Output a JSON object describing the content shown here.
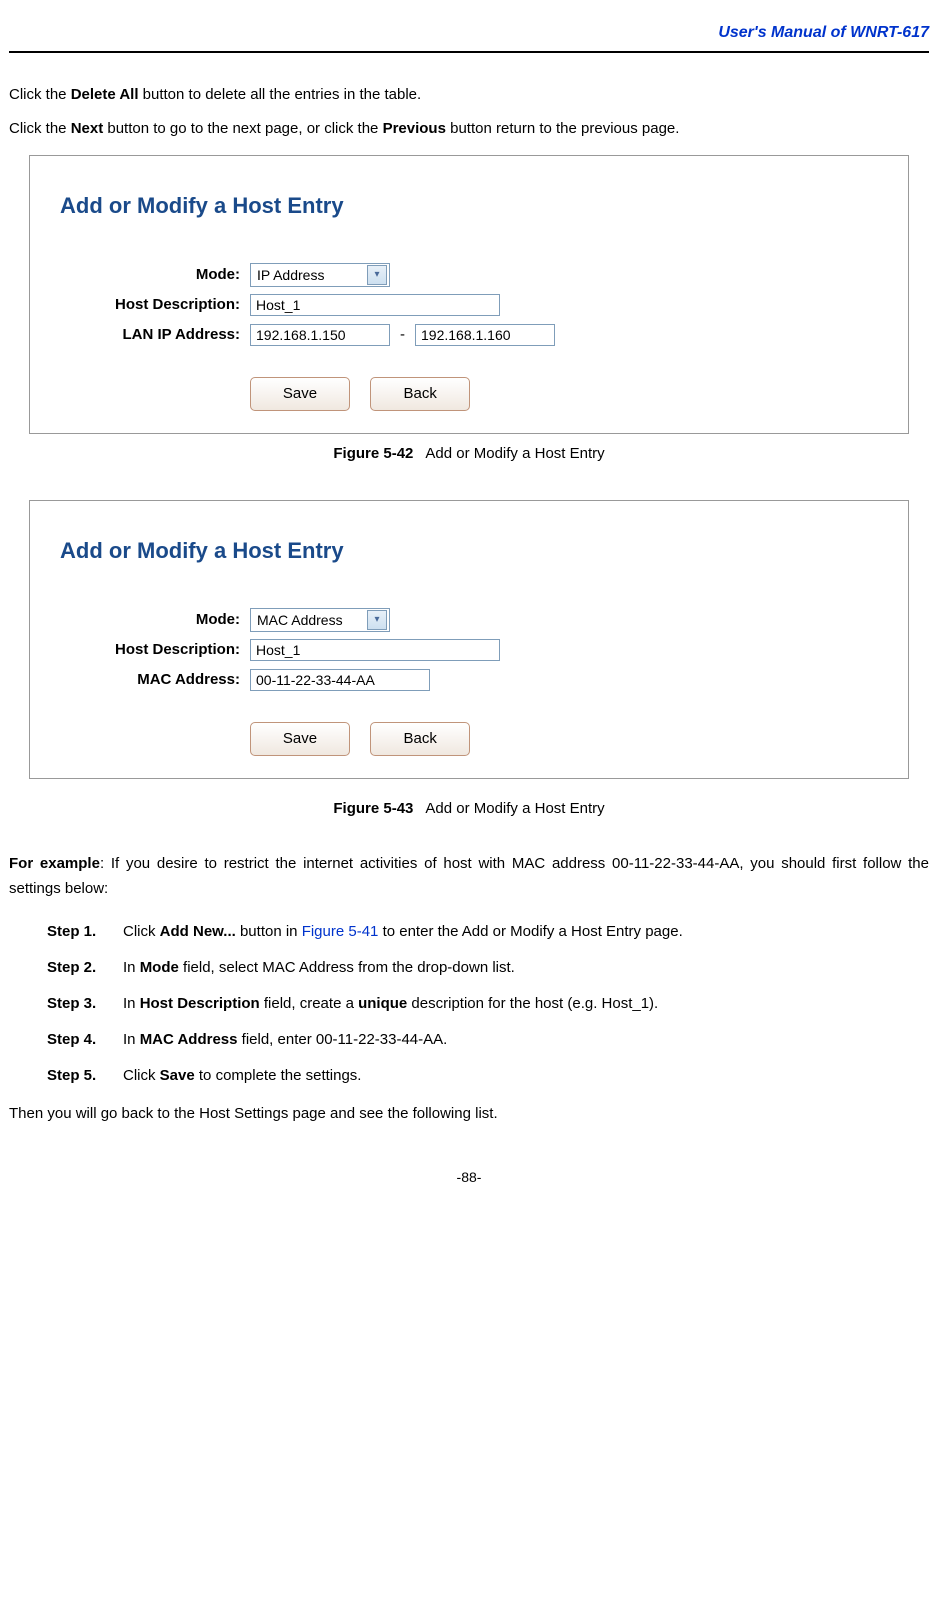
{
  "header": {
    "title": "User's Manual of WNRT-617"
  },
  "intro": {
    "line1_a": "Click the ",
    "line1_b": "Delete All",
    "line1_c": " button to delete all the entries in the table.",
    "line2_a": "Click the ",
    "line2_b": "Next",
    "line2_c": " button to go to the next page, or click the ",
    "line2_d": "Previous",
    "line2_e": " button return to the previous page."
  },
  "fig1": {
    "heading": "Add or Modify a Host Entry",
    "mode_label": "Mode:",
    "mode_value": "IP Address",
    "desc_label": "Host Description:",
    "desc_value": "Host_1",
    "ip_label": "LAN IP Address:",
    "ip_from": "192.168.1.150",
    "ip_to": "192.168.1.160",
    "save": "Save",
    "back": "Back",
    "caption_num": "Figure 5-42",
    "caption_text": "Add or Modify a Host Entry"
  },
  "fig2": {
    "heading": "Add or Modify a Host Entry",
    "mode_label": "Mode:",
    "mode_value": "MAC Address",
    "desc_label": "Host Description:",
    "desc_value": "Host_1",
    "mac_label": "MAC Address:",
    "mac_value": "00-11-22-33-44-AA",
    "save": "Save",
    "back": "Back",
    "caption_num": "Figure 5-43",
    "caption_text": "Add or Modify a Host Entry"
  },
  "example": {
    "lead_a": "For example",
    "lead_b": ": If you desire to restrict the internet activities of host with MAC address 00-11-22-33-44-AA, you should first follow the settings below:"
  },
  "steps": [
    {
      "label": "Step 1.",
      "t1": "Click ",
      "b1": "Add New...",
      "t2": " button in ",
      "link": "Figure 5-41",
      "t3": " to enter the Add or Modify a Host Entry page."
    },
    {
      "label": "Step 2.",
      "t1": "In ",
      "b1": "Mode",
      "t2": " field, select MAC Address from the drop-down list.",
      "link": "",
      "t3": ""
    },
    {
      "label": "Step 3.",
      "t1": "In ",
      "b1": "Host Description",
      "t2": " field, create a ",
      "b2": "unique",
      "t3": " description for the host (e.g. Host_1)."
    },
    {
      "label": "Step 4.",
      "t1": "In ",
      "b1": "MAC Address",
      "t2": " field, enter 00-11-22-33-44-AA.",
      "link": "",
      "t3": ""
    },
    {
      "label": "Step 5.",
      "t1": "Click ",
      "b1": "Save",
      "t2": " to complete the settings.",
      "link": "",
      "t3": ""
    }
  ],
  "closing": "Then you will go back to the Host Settings page and see the following list.",
  "page_num": "-88-"
}
